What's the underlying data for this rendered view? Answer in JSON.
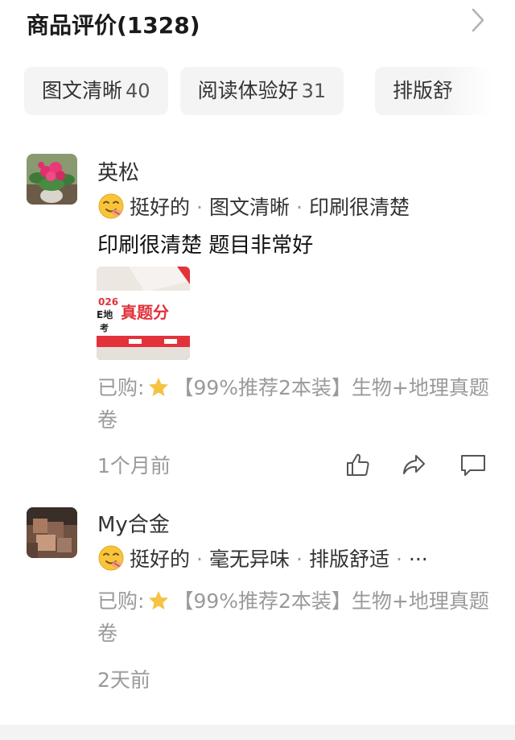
{
  "header": {
    "title": "商品评价(1328)",
    "chevron_icon": "chevron-right-icon"
  },
  "tags": [
    {
      "label": "图文清晰",
      "count": "40"
    },
    {
      "label": "阅读体验好",
      "count": "31"
    },
    {
      "label": "排版舒",
      "count": ""
    }
  ],
  "reviews": [
    {
      "username": "英松",
      "avatar_icon": "flower-photo-avatar",
      "rating_emoji": "smile-emoji-icon",
      "summary": [
        "挺好的",
        "图文清晰",
        "印刷很清楚"
      ],
      "separator": "·",
      "body": "印刷很清楚 题目非常好",
      "photo": {
        "lines": [
          "026",
          "E地",
          "考"
        ],
        "banner": "真题分"
      },
      "purchased_prefix": "已购:",
      "purchased_item": "【99%推荐2本装】生物+地理真题卷",
      "time": "1个月前",
      "actions": [
        "thumbs-up-icon",
        "share-icon",
        "comment-icon"
      ]
    },
    {
      "username": "My合金",
      "avatar_icon": "blurred-avatar",
      "rating_emoji": "smile-emoji-icon",
      "summary": [
        "挺好的",
        "毫无异味",
        "排版舒适"
      ],
      "summary_more": "···",
      "separator": "·",
      "purchased_prefix": "已购:",
      "purchased_item": "【99%推荐2本装】生物+地理真题卷",
      "time": "2天前"
    }
  ],
  "colors": {
    "tag_bg": "#f4f4f4",
    "muted_text": "#9a9a9a",
    "photo_red": "#e2323a",
    "star": "#f5c242"
  }
}
